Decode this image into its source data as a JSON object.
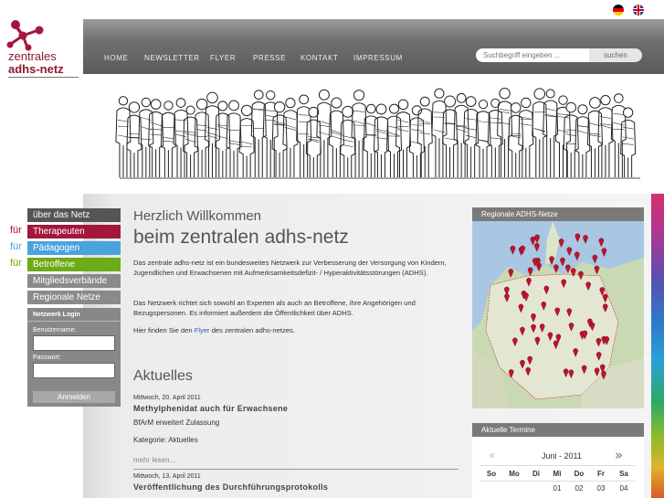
{
  "logo": {
    "line1": "zentrales",
    "line2": "adhs-netz"
  },
  "languages": [
    {
      "code": "de",
      "icon": "german-flag-icon"
    },
    {
      "code": "en",
      "icon": "english-flag-icon"
    }
  ],
  "nav": {
    "items": [
      "HOME",
      "NEWSLETTER",
      "FLYER",
      "PRESSE",
      "KONTAKT",
      "IMPRESSUM"
    ],
    "search_placeholder": "Suchbegriff eingeben ...",
    "search_button": "suchen"
  },
  "sidebar": {
    "ueber": "über das Netz",
    "fuer_label": "für",
    "therapeuten": "Therapeuten",
    "paedagogen": "Pädagogen",
    "betroffene": "Betroffene",
    "mitglieder": "Mitgliedsverbände",
    "regionale": "Regionale Netze",
    "colors": {
      "therapeuten": "#a3173c",
      "paedagogen": "#4aa3df",
      "betroffene": "#6dab17",
      "gray": "#8a8a8a",
      "dark": "#555555"
    }
  },
  "login": {
    "title": "Netzwerk Login",
    "user_label": "Benutzername:",
    "pass_label": "Passwort:",
    "button": "Anmelden"
  },
  "welcome": {
    "line1": "Herzlich Willkommen",
    "line2": "beim zentralen adhs-netz",
    "p1": "Das zentrale adhs-netz ist ein bundesweites Netzwerk zur Verbesserung der Versorgung von Kindern, Jugendlichen und Erwachsenen mit Aufmerksamkeitsdefizit- / Hyperaktivitätsstörungen (ADHS).",
    "p2": "Das Netzwerk richtet sich sowohl an Experten als auch an Betroffene, ihre Angehörigen und Bezugspersonen. Es informiert außerdem die Öffentlichkeit über ADHS.",
    "p3_pre": "Hier finden Sie den ",
    "p3_link": "Flyer",
    "p3_post": " des zentralen adhs-netzes."
  },
  "news": {
    "heading": "Aktuelles",
    "items": [
      {
        "date": "Mittwoch, 20. April 2011",
        "title": "Methylphenidat auch für Erwachsene",
        "text": "BfArM erweitert Zulassung",
        "category": "Kategorie: Aktuelles",
        "more": "mehr lesen..."
      },
      {
        "date": "Mittwoch, 13. April 2011",
        "title": "Veröffentlichung des Durchführungsprotokolls"
      }
    ]
  },
  "map": {
    "title": "Regionale ADHS-Netze"
  },
  "calendar": {
    "title": "Aktuelle Termine",
    "month": "Juni - 2011",
    "prev": "«",
    "next": "»",
    "days": [
      "So",
      "Mo",
      "Di",
      "Mi",
      "Do",
      "Fr",
      "Sa"
    ],
    "first_row": [
      "",
      "",
      "",
      "01",
      "02",
      "03",
      "04"
    ]
  }
}
